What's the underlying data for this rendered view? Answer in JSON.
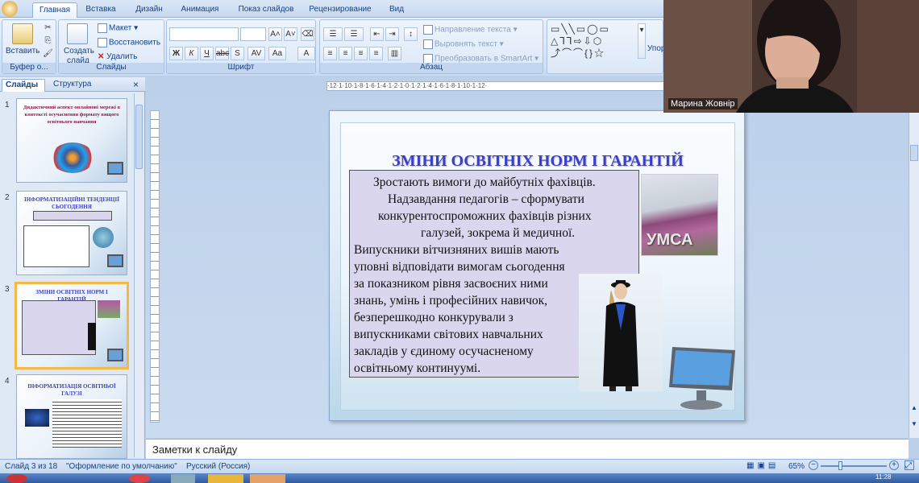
{
  "ribbon": {
    "tabs": [
      "Главная",
      "Вставка",
      "Дизайн",
      "Анимация",
      "Показ слайдов",
      "Рецензирование",
      "Вид"
    ],
    "active_tab": "Главная",
    "groups": {
      "clipboard": {
        "label": "Буфер о...",
        "paste": "Вставить"
      },
      "slides": {
        "label": "Слайды",
        "create": "Создать",
        "create2": "слайд",
        "layout": "Макет",
        "restore": "Восстановить",
        "delete": "Удалить"
      },
      "font": {
        "label": "Шрифт"
      },
      "paragraph": {
        "label": "Абзац",
        "text_direction": "Направление текста",
        "align_text": "Выровнять текст",
        "smartart": "Преобразовать в SmartArt"
      },
      "drawing": {
        "label": "Упор"
      }
    }
  },
  "left_panel": {
    "tabs": [
      "Слайды",
      "Структура"
    ],
    "close": "×",
    "thumbnails": [
      {
        "num": "1",
        "title": "Дидактичний аспект онлайнові мережі в контексті осучаснення формату вищого освітнього навчання"
      },
      {
        "num": "2",
        "title": "ІНФОРМАТИЗАЦІЙНІ ТЕНДЕНЦІЇ СЬОГОДЕННЯ"
      },
      {
        "num": "3",
        "title": "ЗМІНИ ОСВІТНІХ НОРМ І ГАРАНТІЙ"
      },
      {
        "num": "4",
        "title": "ІНФОРМАТИЗАЦІЯ ОСВІТНЬОЇ ГАЛУЗІ"
      }
    ],
    "selected": "3"
  },
  "ruler": "·12·1·10·1·8·1·6·1·4·1·2·1·0·1·2·1·4·1·6·1·8·1·10·1·12·",
  "slide": {
    "title": "ЗМІНИ ОСВІТНІХ НОРМ І ГАРАНТІЙ",
    "lines_center": [
      "Зростають вимоги до майбутніх фахівців.",
      "Надзавдання педагогів – сформувати",
      "конкурентоспроможних фахівців різних",
      "галузей, зокрема й медичної."
    ],
    "lines_left": [
      "Випускники вітчизняних вишів мають",
      "уповні відповідати вимогам сьогодення",
      "за показником рівня засвоєних ними",
      "знань, умінь і професійних навичок,",
      "безперешкодно конкурували з",
      "випускниками світових навчальних",
      "закладів у єдиному осучасненому",
      "освітньому континуумі."
    ],
    "image_text": "УМСА"
  },
  "notes_placeholder": "Заметки к слайду",
  "status": {
    "slide": "Слайд 3 из 18",
    "theme": "\"Оформление по умолчанию\"",
    "language": "Русский (Россия)",
    "zoom": "65%",
    "clock": "11:28"
  },
  "video": {
    "participant": "Марина Жовнір"
  },
  "colors": {
    "title": "#3b3fc8",
    "selected_border": "#f3b846",
    "text_box": "#d9d6ee"
  }
}
